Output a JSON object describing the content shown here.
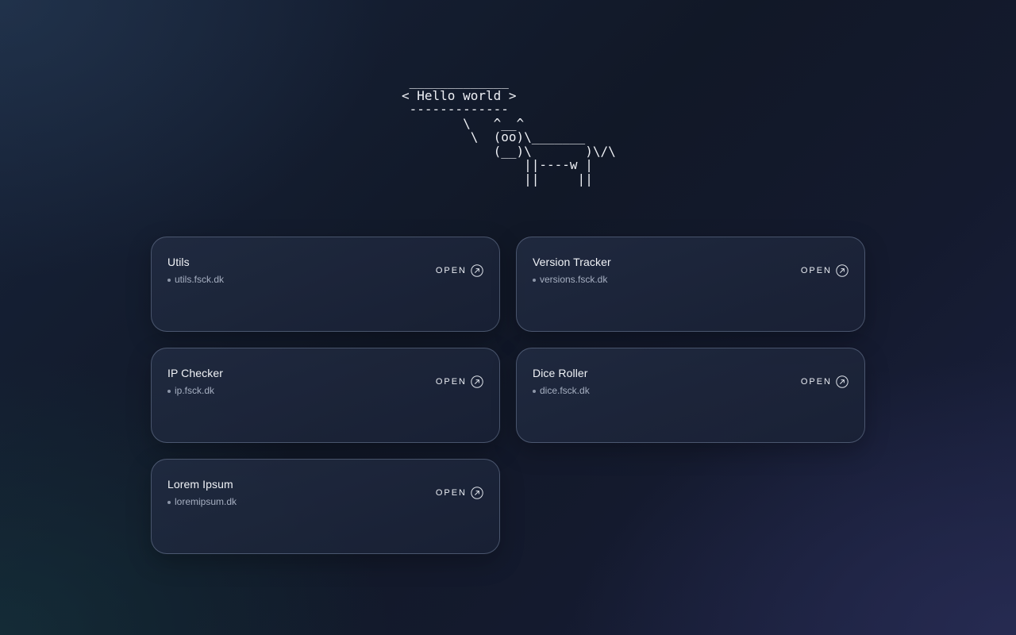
{
  "banner": {
    "ascii_art": " _____________\n< Hello world >\n -------------\n        \\   ^__^\n         \\  (oo)\\_______\n            (__)\\       )\\/\\\n                ||----w |\n                ||     ||"
  },
  "cards": [
    {
      "title": "Utils",
      "url": "utils.fsck.dk",
      "action": "OPEN",
      "icon": "external-link-icon"
    },
    {
      "title": "Version Tracker",
      "url": "versions.fsck.dk",
      "action": "OPEN",
      "icon": "external-link-icon"
    },
    {
      "title": "IP Checker",
      "url": "ip.fsck.dk",
      "action": "OPEN",
      "icon": "external-link-icon"
    },
    {
      "title": "Dice Roller",
      "url": "dice.fsck.dk",
      "action": "OPEN",
      "icon": "external-link-icon"
    },
    {
      "title": "Lorem Ipsum",
      "url": "loremipsum.dk",
      "action": "OPEN",
      "icon": "external-link-icon"
    }
  ],
  "colors": {
    "background_dark": "#111827",
    "card_border": "#5a6582",
    "text_primary": "#f1f3f7",
    "text_secondary": "#a6afc1"
  }
}
